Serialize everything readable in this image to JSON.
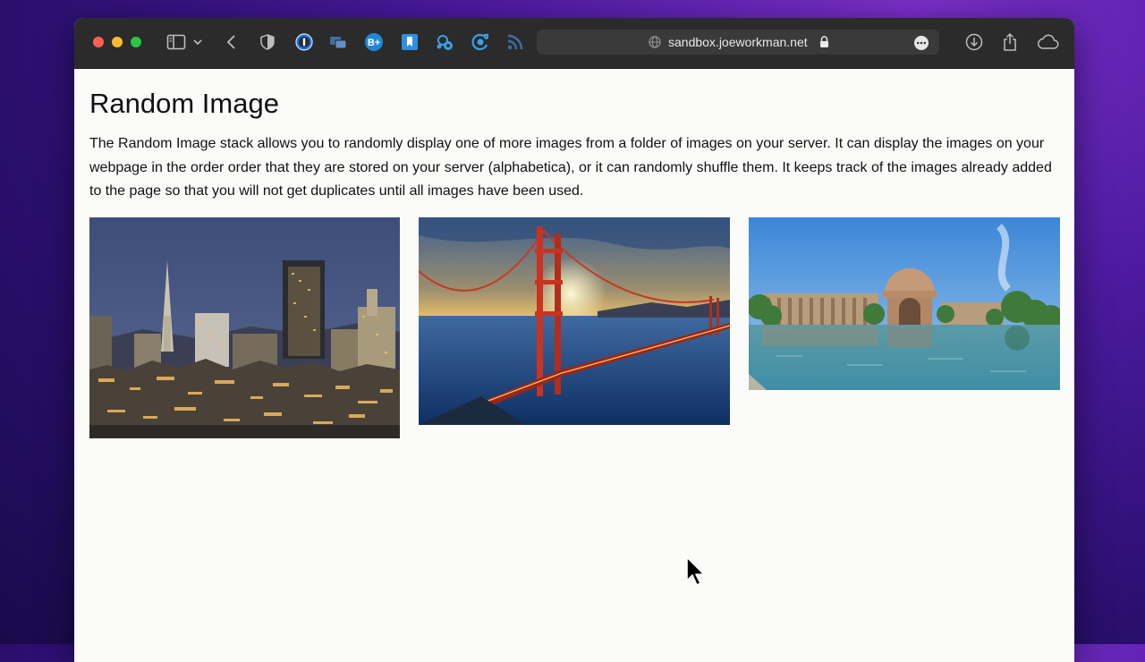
{
  "browser": {
    "url": "sandbox.joeworkman.net"
  },
  "page": {
    "title": "Random Image",
    "description": "The Random Image stack allows you to randomly display one of more images from a folder of images on your server. It can display the images on your webpage in the order order that they are stored on your server (alphabetica), or it can randomly shuffle them. It keeps track of the images already added to the page so that you will not get duplicates until all images have been used."
  },
  "images": [
    {
      "name": "san-francisco-skyline-night"
    },
    {
      "name": "golden-gate-bridge-sunset"
    },
    {
      "name": "palace-of-fine-arts"
    }
  ],
  "icons": [
    "sidebar-icon",
    "chevron-down-icon",
    "back-icon",
    "shield-icon",
    "onepassword-icon",
    "tab-overview-icon",
    "bplus-extension-icon",
    "bookmark-icon",
    "extension-icon",
    "refresh-extension-icon",
    "rss-icon",
    "globe-icon",
    "lock-icon",
    "more-icon",
    "download-icon",
    "share-icon",
    "cloud-icon"
  ]
}
